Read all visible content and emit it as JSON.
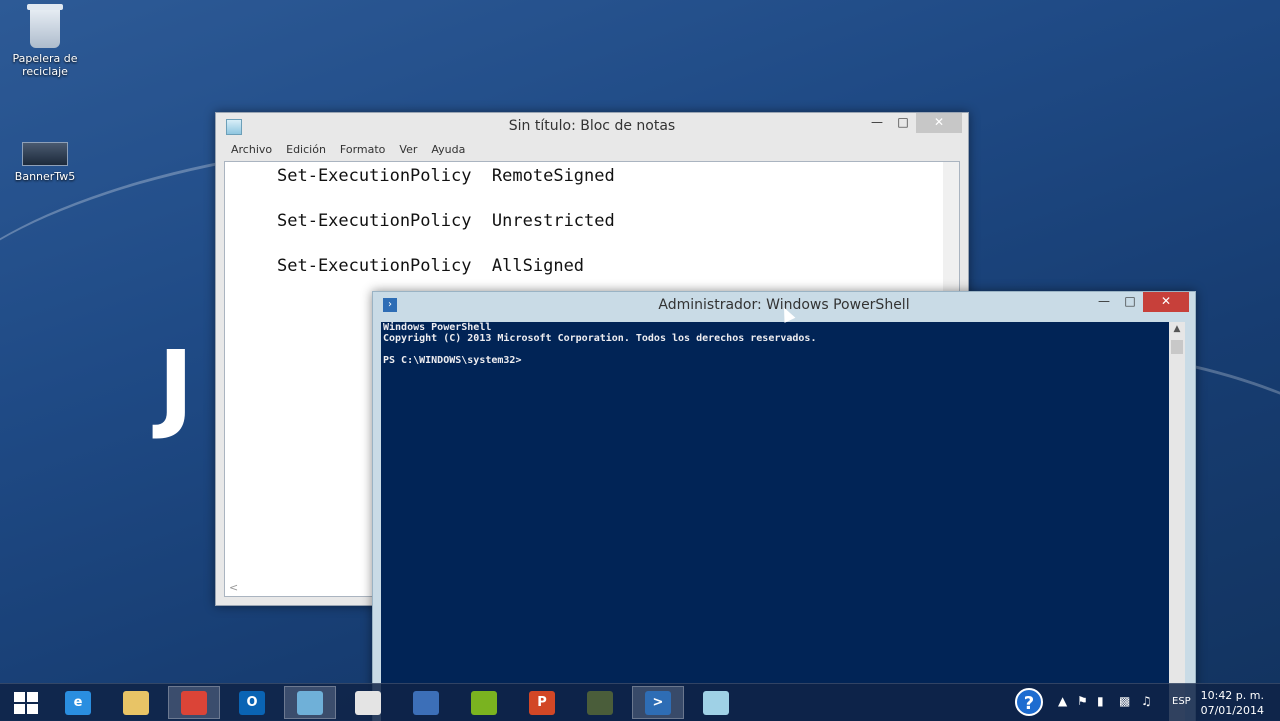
{
  "desktop": {
    "icons": [
      {
        "label": "Papelera de reciclaje",
        "icon": "recycle-bin-icon"
      },
      {
        "label": "BannerTw5",
        "icon": "banner-shortcut-icon"
      }
    ],
    "wallpaper_text": "J"
  },
  "notepad": {
    "title": "Sin título: Bloc de notas",
    "menu": [
      "Archivo",
      "Edición",
      "Formato",
      "Ver",
      "Ayuda"
    ],
    "lines": [
      "Set-ExecutionPolicy  RemoteSigned",
      "Set-ExecutionPolicy  Unrestricted",
      "Set-ExecutionPolicy  AllSigned"
    ]
  },
  "powershell": {
    "title": "Administrador: Windows PowerShell",
    "lines": [
      "Windows PowerShell",
      "Copyright (C) 2013 Microsoft Corporation. Todos los derechos reservados.",
      "",
      "PS C:\\WINDOWS\\system32>"
    ],
    "console_bg": "#012456"
  },
  "taskbar": {
    "items": [
      {
        "name": "internet-explorer-icon",
        "glyph": "e",
        "color": "#2a8ee0"
      },
      {
        "name": "file-explorer-icon",
        "glyph": "",
        "color": "#e8c466"
      },
      {
        "name": "chrome-icon",
        "glyph": "",
        "color": "#db4437"
      },
      {
        "name": "outlook-icon",
        "glyph": "O",
        "color": "#0a64b4"
      },
      {
        "name": "city-app-icon",
        "glyph": "",
        "color": "#6fb0d8"
      },
      {
        "name": "apps-grid-icon",
        "glyph": "",
        "color": "#e4e4e4"
      },
      {
        "name": "remote-desktop-icon",
        "glyph": "",
        "color": "#3c6fb8"
      },
      {
        "name": "spotify-icon",
        "glyph": "",
        "color": "#7ab320"
      },
      {
        "name": "powerpoint-icon",
        "glyph": "P",
        "color": "#d24726"
      },
      {
        "name": "camtasia-icon",
        "glyph": "",
        "color": "#4a5d3a"
      },
      {
        "name": "powershell-icon",
        "glyph": ">",
        "color": "#2e6db5"
      },
      {
        "name": "notepad-icon",
        "glyph": "",
        "color": "#9fd1e6"
      }
    ],
    "tray": {
      "language": "ESP",
      "time": "10:42 p. m.",
      "date": "07/01/2014"
    }
  }
}
